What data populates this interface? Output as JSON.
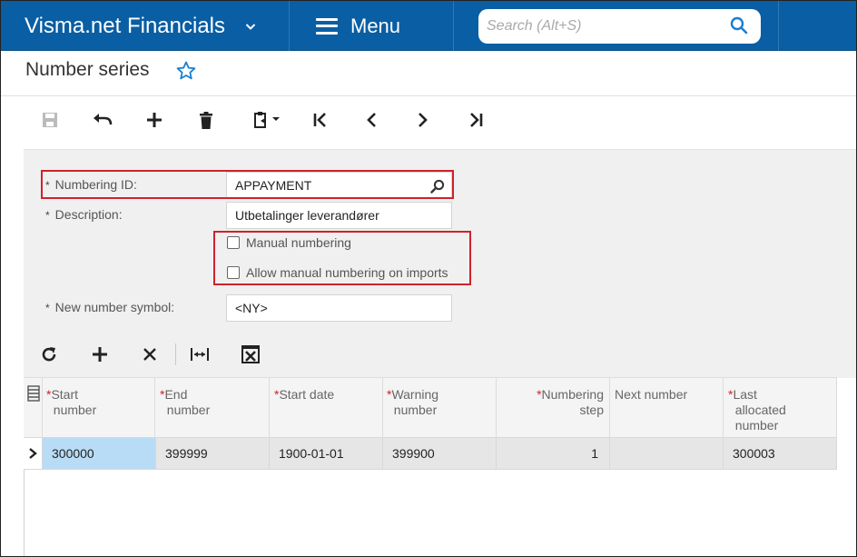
{
  "app": {
    "name": "Visma.net Financials",
    "menu_label": "Menu"
  },
  "search": {
    "placeholder": "Search (Alt+S)"
  },
  "page": {
    "title": "Number series"
  },
  "colors": {
    "topbar": "#0a5ea3",
    "accent": "#1a7fd0",
    "highlight_border": "#d0222b",
    "selected_cell": "#b8dcf5"
  },
  "toolbar": {
    "icons": [
      "save-icon",
      "undo-icon",
      "add-icon",
      "delete-icon",
      "clipboard-icon",
      "first-record-icon",
      "previous-record-icon",
      "next-record-icon",
      "last-record-icon"
    ]
  },
  "form": {
    "numbering_id": {
      "label": "Numbering ID:",
      "value": "APPAYMENT"
    },
    "description": {
      "label": "Description:",
      "value": "Utbetalinger leverandører"
    },
    "manual_numbering": {
      "label": "Manual numbering",
      "checked": false
    },
    "allow_manual_imports": {
      "label": "Allow manual numbering on imports",
      "checked": false
    },
    "new_number_symbol": {
      "label": "New number symbol:",
      "value": "<NY>"
    },
    "required_marker": "*"
  },
  "grid_toolbar": {
    "icons": [
      "refresh-icon",
      "add-row-icon",
      "delete-row-icon",
      "fit-columns-icon",
      "export-excel-icon"
    ]
  },
  "grid": {
    "columns": [
      {
        "line1": "Start",
        "line2": "number",
        "line3": "",
        "required": true
      },
      {
        "line1": "End",
        "line2": "number",
        "line3": "",
        "required": true
      },
      {
        "line1": "Start date",
        "line2": "",
        "line3": "",
        "required": true
      },
      {
        "line1": "Warning",
        "line2": "number",
        "line3": "",
        "required": true
      },
      {
        "line1": "Numbering",
        "line2": "step",
        "line3": "",
        "required": true
      },
      {
        "line1": "Next number",
        "line2": "",
        "line3": "",
        "required": false
      },
      {
        "line1": "Last",
        "line2": "allocated",
        "line3": "number",
        "required": true
      }
    ],
    "rows": [
      {
        "start_number": "300000",
        "end_number": "399999",
        "start_date": "1900-01-01",
        "warning_number": "399900",
        "numbering_step": "1",
        "next_number": "",
        "last_allocated": "300003"
      }
    ]
  }
}
